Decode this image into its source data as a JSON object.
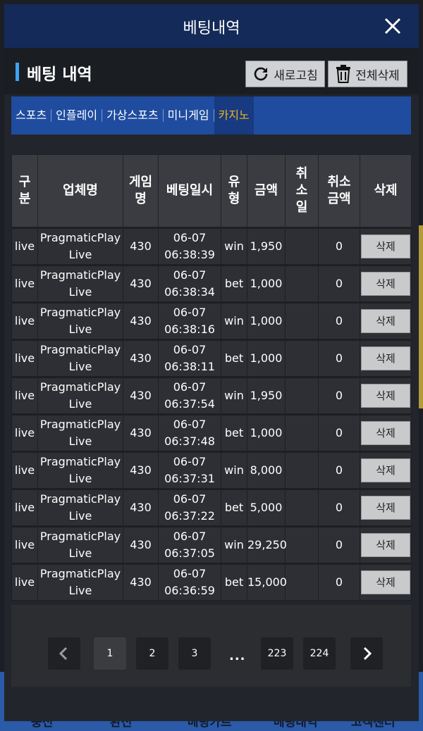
{
  "background_nav": [
    "충전",
    "환전",
    "베팅카트",
    "베팅내역",
    "고객센터"
  ],
  "modal": {
    "title": "베팅내역",
    "section_title": "베팅 내역",
    "refresh_label": "새로고침",
    "delete_all_label": "전체삭제"
  },
  "tabs": [
    {
      "label": "스포츠",
      "active": false
    },
    {
      "label": "인플레이",
      "active": false
    },
    {
      "label": "가상스포츠",
      "active": false
    },
    {
      "label": "미니게임",
      "active": false
    },
    {
      "label": "카지노",
      "active": true
    }
  ],
  "table": {
    "headers": {
      "type": [
        "구",
        "분"
      ],
      "vendor": [
        "업체명"
      ],
      "game": [
        "게임",
        "명"
      ],
      "datetime": [
        "베팅일시"
      ],
      "kind": [
        "유",
        "형"
      ],
      "amount": [
        "금액"
      ],
      "cancel_date": [
        "취",
        "소",
        "일"
      ],
      "cancel_amount": [
        "취소",
        "금액"
      ],
      "delete": [
        "삭제"
      ]
    },
    "delete_label": "삭제",
    "rows": [
      {
        "type": "live",
        "vendor": [
          "PragmaticPlay",
          "Live"
        ],
        "game": "430",
        "date": "06-07",
        "time": "06:38:39",
        "kind": "win",
        "amount": "1,950",
        "cancel_date": "",
        "cancel_amount": "0"
      },
      {
        "type": "live",
        "vendor": [
          "PragmaticPlay",
          "Live"
        ],
        "game": "430",
        "date": "06-07",
        "time": "06:38:34",
        "kind": "bet",
        "amount": "1,000",
        "cancel_date": "",
        "cancel_amount": "0"
      },
      {
        "type": "live",
        "vendor": [
          "PragmaticPlay",
          "Live"
        ],
        "game": "430",
        "date": "06-07",
        "time": "06:38:16",
        "kind": "win",
        "amount": "1,000",
        "cancel_date": "",
        "cancel_amount": "0"
      },
      {
        "type": "live",
        "vendor": [
          "PragmaticPlay",
          "Live"
        ],
        "game": "430",
        "date": "06-07",
        "time": "06:38:11",
        "kind": "bet",
        "amount": "1,000",
        "cancel_date": "",
        "cancel_amount": "0"
      },
      {
        "type": "live",
        "vendor": [
          "PragmaticPlay",
          "Live"
        ],
        "game": "430",
        "date": "06-07",
        "time": "06:37:54",
        "kind": "win",
        "amount": "1,950",
        "cancel_date": "",
        "cancel_amount": "0"
      },
      {
        "type": "live",
        "vendor": [
          "PragmaticPlay",
          "Live"
        ],
        "game": "430",
        "date": "06-07",
        "time": "06:37:48",
        "kind": "bet",
        "amount": "1,000",
        "cancel_date": "",
        "cancel_amount": "0"
      },
      {
        "type": "live",
        "vendor": [
          "PragmaticPlay",
          "Live"
        ],
        "game": "430",
        "date": "06-07",
        "time": "06:37:31",
        "kind": "win",
        "amount": "8,000",
        "cancel_date": "",
        "cancel_amount": "0"
      },
      {
        "type": "live",
        "vendor": [
          "PragmaticPlay",
          "Live"
        ],
        "game": "430",
        "date": "06-07",
        "time": "06:37:22",
        "kind": "bet",
        "amount": "5,000",
        "cancel_date": "",
        "cancel_amount": "0"
      },
      {
        "type": "live",
        "vendor": [
          "PragmaticPlay",
          "Live"
        ],
        "game": "430",
        "date": "06-07",
        "time": "06:37:05",
        "kind": "win",
        "amount": "29,250",
        "cancel_date": "",
        "cancel_amount": "0"
      },
      {
        "type": "live",
        "vendor": [
          "PragmaticPlay",
          "Live"
        ],
        "game": "430",
        "date": "06-07",
        "time": "06:36:59",
        "kind": "bet",
        "amount": "15,000",
        "cancel_date": "",
        "cancel_amount": "0"
      }
    ]
  },
  "pagination": {
    "prev_icon": "chevron-left-icon",
    "next_icon": "chevron-right-icon",
    "pages": [
      "1",
      "2",
      "3"
    ],
    "ellipsis": "...",
    "last_pages": [
      "223",
      "224"
    ],
    "current": "1"
  },
  "colors": {
    "header_bg": "#142a58",
    "tab_bar_bg": "#1f4c9f",
    "active_tab_text": "#f2b31d",
    "accent_bar": "#3ea2f0"
  }
}
